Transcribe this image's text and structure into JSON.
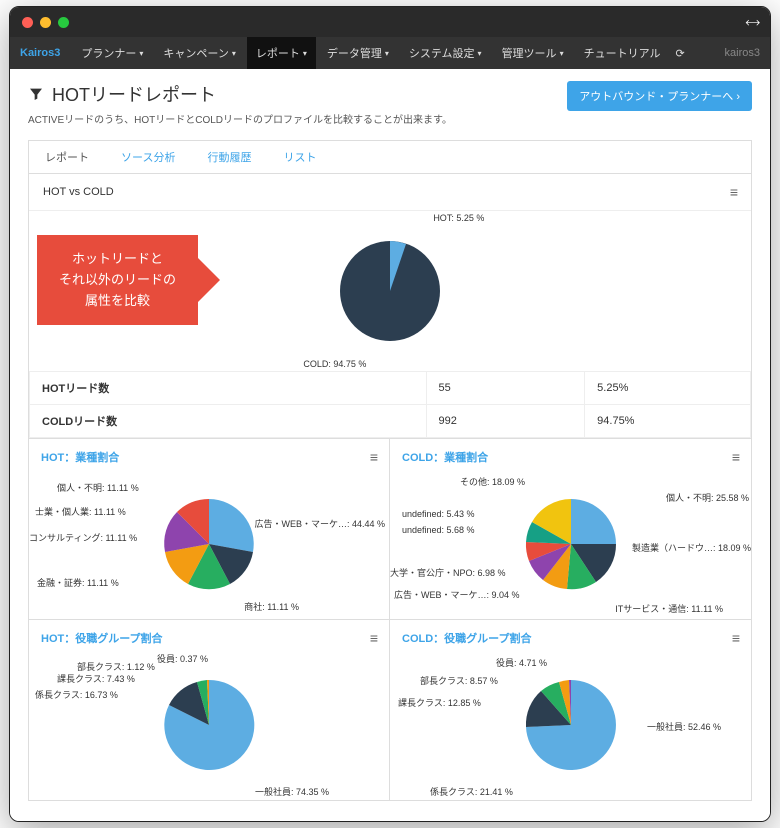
{
  "window": {
    "user": "kairos3"
  },
  "menubar": {
    "brand": "Kairos3",
    "items": [
      "プランナー",
      "キャンペーン",
      "レポート",
      "データ管理",
      "システム設定",
      "管理ツール",
      "チュートリアル"
    ],
    "activeIndex": 2
  },
  "page": {
    "title": "HOTリードレポート",
    "desc": "ACTIVEリードのうち、HOTリードとCOLDリードのプロファイルを比較することが出来ます。",
    "cta": "アウトバウンド・プランナーへ ›"
  },
  "tabs": {
    "items": [
      "レポート",
      "ソース分析",
      "行動履歴",
      "リスト"
    ],
    "activeIndex": 0
  },
  "hotcold": {
    "heading": "HOT vs COLD",
    "labels": {
      "hot": "HOT: 5.25 %",
      "cold": "COLD: 94.75 %"
    }
  },
  "callout": {
    "line1": "ホットリードと",
    "line2": "それ以外のリードの",
    "line3": "属性を比較"
  },
  "table": {
    "row1": {
      "label": "HOTリード数",
      "count": "55",
      "pct": "5.25%"
    },
    "row2": {
      "label": "COLDリード数",
      "count": "992",
      "pct": "94.75%"
    }
  },
  "charts": {
    "hotIndustry": {
      "title": "HOT：業種割合"
    },
    "coldIndustry": {
      "title": "COLD：業種割合"
    },
    "hotRole": {
      "title": "HOT：役職グループ割合"
    },
    "coldRole": {
      "title": "COLD：役職グループ割合"
    }
  },
  "chart_data": [
    {
      "type": "pie",
      "name": "HOT vs COLD",
      "series": [
        {
          "name": "HOT",
          "value": 5.25,
          "count": 55
        },
        {
          "name": "COLD",
          "value": 94.75,
          "count": 992
        }
      ]
    },
    {
      "type": "pie",
      "name": "HOT：業種割合",
      "series": [
        {
          "name": "広告・WEB・マーケ…",
          "value": 44.44
        },
        {
          "name": "商社",
          "value": 11.11
        },
        {
          "name": "金融・証券",
          "value": 11.11
        },
        {
          "name": "コンサルティング",
          "value": 11.11
        },
        {
          "name": "士業・個人業",
          "value": 11.11
        },
        {
          "name": "個人・不明",
          "value": 11.11
        }
      ]
    },
    {
      "type": "pie",
      "name": "COLD：業種割合",
      "series": [
        {
          "name": "個人・不明",
          "value": 25.58
        },
        {
          "name": "製造業（ハードウ…",
          "value": 18.09
        },
        {
          "name": "ITサービス・通信",
          "value": 11.11
        },
        {
          "name": "広告・WEB・マーケ…",
          "value": 9.04
        },
        {
          "name": "大学・官公庁・NPO",
          "value": 6.98
        },
        {
          "name": "undefined",
          "value": 5.68
        },
        {
          "name": "undefined",
          "value": 5.43
        },
        {
          "name": "その他",
          "value": 18.09
        }
      ]
    },
    {
      "type": "pie",
      "name": "HOT：役職グループ割合",
      "series": [
        {
          "name": "一般社員",
          "value": 74.35
        },
        {
          "name": "係長クラス",
          "value": 16.73
        },
        {
          "name": "課長クラス",
          "value": 7.43
        },
        {
          "name": "部長クラス",
          "value": 1.12
        },
        {
          "name": "役員",
          "value": 0.37
        }
      ]
    },
    {
      "type": "pie",
      "name": "COLD：役職グループ割合",
      "series": [
        {
          "name": "一般社員",
          "value": 52.46
        },
        {
          "name": "係長クラス",
          "value": 21.41
        },
        {
          "name": "課長クラス",
          "value": 12.85
        },
        {
          "name": "部長クラス",
          "value": 8.57
        },
        {
          "name": "役員",
          "value": 4.71
        }
      ]
    }
  ],
  "labels": {
    "hotIndustry": {
      "l0": "広告・WEB・マーケ…: 44.44 %",
      "l1": "商社: 11.11 %",
      "l2": "金融・証券: 11.11 %",
      "l3": "コンサルティング: 11.11 %",
      "l4": "士業・個人業: 11.11 %",
      "l5": "個人・不明: 11.11 %"
    },
    "coldIndustry": {
      "l0": "個人・不明: 25.58 %",
      "l1": "製造業（ハードウ…: 18.09 %",
      "l2": "ITサービス・通信: 11.11 %",
      "l3": "広告・WEB・マーケ…: 9.04 %",
      "l4": "大学・官公庁・NPO: 6.98 %",
      "l5": "undefined: 5.68 %",
      "l6": "undefined: 5.43 %",
      "l7": "その他: 18.09 %"
    },
    "hotRole": {
      "l0": "一般社員: 74.35 %",
      "l1": "係長クラス: 16.73 %",
      "l2": "課長クラス: 7.43 %",
      "l3": "部長クラス: 1.12 %",
      "l4": "役員: 0.37 %"
    },
    "coldRole": {
      "l0": "一般社員: 52.46 %",
      "l1": "係長クラス: 21.41 %",
      "l2": "課長クラス: 12.85 %",
      "l3": "部長クラス: 8.57 %",
      "l4": "役員: 4.71 %"
    }
  }
}
